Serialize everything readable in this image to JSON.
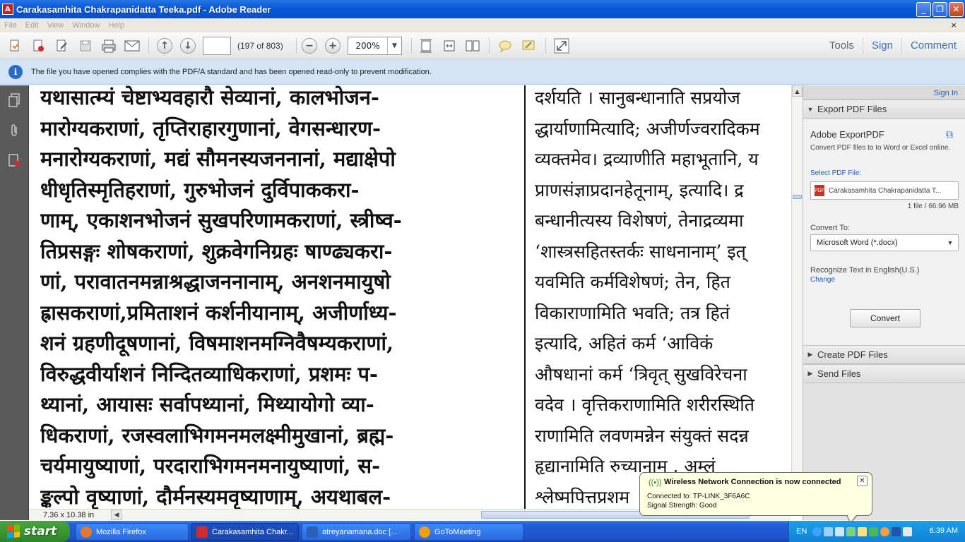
{
  "window": {
    "title": "Carakasamhita Chakrapanidatta Teeka.pdf - Adobe Reader",
    "minimize": "_",
    "maximize": "❐",
    "close": "✕"
  },
  "menu": {
    "items": [
      "File",
      "Edit",
      "View",
      "Window",
      "Help"
    ],
    "close_glyph": "×"
  },
  "toolbar": {
    "page_number": "",
    "page_count": "(197 of 803)",
    "zoom": "200%",
    "tools": "Tools",
    "sign": "Sign",
    "comment": "Comment"
  },
  "infobar": {
    "message": "The file you have opened complies with the PDF/A standard and has been opened read-only to prevent modification."
  },
  "document": {
    "left_column": [
      "यथासात्म्यं चेष्टाभ्यवहारौ सेव्यानां, कालभोजन-",
      "मारोग्यकराणां, तृप्तिराहारगुणानां, वेगसन्धारण-",
      "मनारोग्यकराणां, मद्यं सौमनस्यजननानां, मद्याक्षेपो",
      "धीधृतिस्मृतिहराणां, गुरुभोजनं दुर्विपाककरा-",
      "णाम्, एकाशनभोजनं सुखपरिणामकराणां, स्त्रीष्व-",
      "तिप्रसङ्गः शोषकराणां, शुक्रवेगनिग्रहः षाण्ढ्यकरा-",
      "णां, परावातनमन्नाश्रद्धाजननानाम्, अनशनमायुषो",
      "ह्रासकराणां,प्रमिताशनं कर्शनीयानाम्, अजीर्णाध्य-",
      "शनं ग्रहणीदूषणानां, विषमाशनमग्निवैषम्यकराणां,",
      "विरुद्धवीर्याशनं निन्दितव्याधिकराणां, प्रशमः प-",
      "थ्यानां, आयासः सर्वापथ्यानां, मिथ्यायोगो व्या-",
      "धिकराणां, रजस्वलाभिगमनमलक्ष्मीमुखानां, ब्रह्म-",
      "चर्यमायुष्याणां, परदाराभिगमनमनायुष्याणां, स-",
      "ङ्कल्पो वृष्याणां, दौर्मनस्यमवृष्याणाम्, अयथाबल-"
    ],
    "right_column": [
      "दर्शयति । सानुबन्धानाति सप्रयोज",
      "द्धार्याणामित्यादि; अजीर्णज्वरादिकम",
      "व्यक्तमेव। द्रव्याणीति महाभूतानि, य",
      "प्राणसंज्ञाप्रदानहेतूनाम्, इत्यादि। द्र",
      "बन्धानीत्यस्य विशेषणं, तेनाद्रव्यमा",
      "‘शास्त्रसहितस्तर्कः साधनानाम्’ इत्",
      "यवमिति कर्मविशेषणं; तेन, हित",
      "विकाराणामिति भवति; तत्र हितं",
      "इत्यादि, अहितं कर्म ‘आविकं",
      "औषधानां कर्म ‘त्रिवृत् सुखविरेचना",
      "वदेव । वृत्तिकराणामिति शरीरस्थिति",
      "राणामिति लवणमन्नेन संयुक्तं सदन्न",
      "हृद्यानामिति रुच्यानाम् , अम्लं",
      "श्लेष्मपित्तप्रशम"
    ]
  },
  "statusbar": {
    "page_dimensions": "7.36 x 10.38 in"
  },
  "right_panel": {
    "sign_in": "Sign In",
    "export_header": "Export PDF Files",
    "export_title": "Adobe ExportPDF",
    "export_desc": "Convert PDF files to to Word or Excel online.",
    "select_label": "Select PDF File:",
    "selected_file": "Carakasamhita Chakrapanidatta T...",
    "file_info": "1 file / 66.96 MB",
    "convert_to_label": "Convert To:",
    "convert_to_value": "Microsoft Word (*.docx)",
    "recognize_text": "Recognize Text in English(U.S.)",
    "change_link": "Change",
    "convert_button": "Convert",
    "create_header": "Create PDF Files",
    "send_header": "Send Files"
  },
  "notification": {
    "title": "Wireless Network Connection is now connected",
    "line1": "Connected to: TP-LINK_3F6A6C",
    "line2": "Signal Strength: Good",
    "close": "✕"
  },
  "taskbar": {
    "start": "start",
    "tasks": [
      {
        "label": "Mozilla Firefox",
        "color": "#e8762b"
      },
      {
        "label": "Carakasamhita Chakr...",
        "color": "#d42a2a"
      },
      {
        "label": "atreyanamana.doc [...",
        "color": "#2b5fb8"
      },
      {
        "label": "GoToMeeting",
        "color": "#f2a000"
      }
    ],
    "language": "EN",
    "clock": "6:39 AM"
  }
}
